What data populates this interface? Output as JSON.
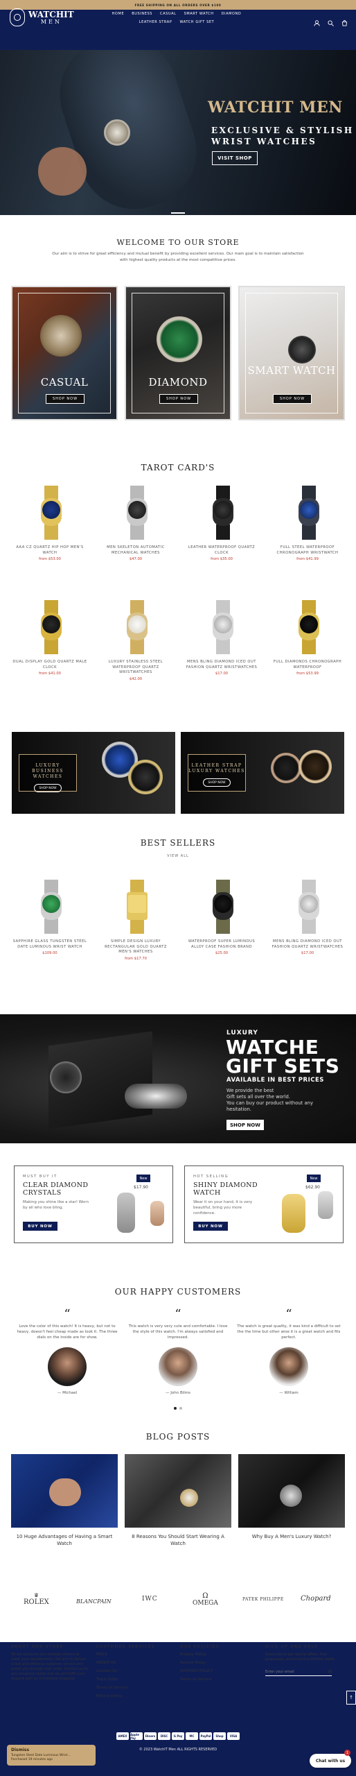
{
  "topbar": {
    "text": "FREE SHIPPING ON ALL ORDERS OVER $100"
  },
  "logo": {
    "line1": "WATCHIT",
    "line2": "MEN"
  },
  "nav": {
    "items": [
      "HOME",
      "BUSINESS",
      "CASUAL",
      "SMART WATCH",
      "DIAMOND",
      "LEATHER STRAP",
      "WATCH GIFT SET"
    ]
  },
  "header_icons": [
    "user-icon",
    "search-icon",
    "cart-icon"
  ],
  "hero": {
    "title": "WATCHIT MEN",
    "subtitle_line1": "EXCLUSIVE & STYLISH",
    "subtitle_line2": "WRIST WATCHES",
    "button": "VISIT SHOP"
  },
  "welcome": {
    "title": "WELCOME TO OUR STORE",
    "text": "Our aim is to strive for great efficiency and mutual benefit by providing excellent services. Our main goal is to maintain satisfaction with highest quality products at the most competitive prices."
  },
  "categories": [
    {
      "label": "CASUAL",
      "button": "SHOP NOW"
    },
    {
      "label": "DIAMOND",
      "button": "SHOP NOW"
    },
    {
      "label": "SMART WATCH",
      "button": "SHOP NOW"
    }
  ],
  "tarot": {
    "title": "TAROT CARD'S",
    "products": [
      {
        "name": "AAA CZ QUARTZ HIP HOP MEN'S WATCH",
        "price": "from $53.00"
      },
      {
        "name": "MEN SKELETON AUTOMATIC MECHANICAL WATCHES",
        "price": "$47.00"
      },
      {
        "name": "LEATHER WATERPROOF QUARTZ CLOCK",
        "price": "from $35.00"
      },
      {
        "name": "FULL STEEL WATERPROOF CHRONOGRAPH WRISTWATCH",
        "price": "from $41.99"
      },
      {
        "name": "DUAL DISPLAY GOLD QUARTZ MALE CLOCK",
        "price": "from $41.00"
      },
      {
        "name": "LUXURY STAINLESS STEEL WATERPROOF QUARTZ WRISTWATCHES",
        "price": "$42.00"
      },
      {
        "name": "MENS BLING DIAMOND ICED OUT FASHION QUARTZ WRISTWATCHES",
        "price": "$17.00"
      },
      {
        "name": "FULL DIAMONDS CHRONOGRAPH WATERPROOF",
        "price": "from $53.99"
      }
    ]
  },
  "banners": [
    {
      "line1": "LUXURY",
      "line2": "BUSINESS WATCHES",
      "button": "SHOP NOW"
    },
    {
      "line1": "LEATHER STRAP",
      "line2": "LUXURY WATCHES",
      "button": "SHOP NOW"
    }
  ],
  "best_sellers": {
    "title": "BEST SELLERS",
    "view_all": "VIEW ALL",
    "products": [
      {
        "name": "SAPPHIRE GLASS TUNGSTEN STEEL DATE LUMINOUS WRIST WATCH",
        "price": "$109.00"
      },
      {
        "name": "SIMPLE DESIGN LUXURY RECTANGULAR GOLD QUARTZ MEN'S WATCHES",
        "price": "from $17.70"
      },
      {
        "name": "WATERPROOF SUPER LUMINOUS ALLOY CASE FASHION BRAND",
        "price": "$25.00"
      },
      {
        "name": "MENS BLING DIAMOND ICED OUT FASHION QUARTZ WRISTWATCHES",
        "price": "$17.00"
      }
    ]
  },
  "gift": {
    "line1": "LUXURY",
    "line2a": "WATCHE",
    "line2b": "GIFT SETS",
    "line3": "AVAILABLE IN BEST PRICES",
    "desc": [
      "We provide the best",
      "Gift sets all over the world.",
      "You can buy our product without any",
      "hesitation."
    ],
    "button": "SHOP NOW"
  },
  "promos": [
    {
      "kicker": "MUST BUY IT",
      "title1": "CLEAR DIAMOND",
      "title2": "CRYSTALS",
      "desc": "Making you shine like a star! Worn by all who love bling.",
      "button": "BUY NOW",
      "badge": "New",
      "price": "$17.90"
    },
    {
      "kicker": "HOT SELLING",
      "title1": "SHINY DIAMOND",
      "title2": "WATCH",
      "desc": "Wear it on your hand, it is very beautiful, bring you more confidence.",
      "button": "BUY NOW",
      "badge": "New",
      "price": "$62.90"
    }
  ],
  "customers": {
    "title": "OUR HAPPY CUSTOMERS",
    "reviews": [
      {
        "text": "Love the color of this watch! It is heavy, but not to heavy, doesn't feel cheap made as look it. The three dials on the inside are for show.",
        "name": "— Michael"
      },
      {
        "text": "This watch is very very cute and comfortable. I love the style of this watch. I'm always satisfied and impressed.",
        "name": "— John Bilms"
      },
      {
        "text": "The watch is great quality, it was kind a difficult to set the the time but other wise it is a great watch and fits perfect.",
        "name": "— William"
      }
    ]
  },
  "blog": {
    "title": "BLOG POSTS",
    "posts": [
      "10 Huge Advantages of Having a Smart Watch",
      "8 Reasons You Should Start Wearing A Watch",
      "Why Buy A Men's Luxury Watch?"
    ]
  },
  "brands": [
    "ROLEX",
    "BLANCPAIN",
    "IWC",
    "OMEGA",
    "PATEK PHILIPPE",
    "Chopard"
  ],
  "footer": {
    "about": {
      "title": "ABOUT OUR STORE",
      "text": "All our products are carefully chosen to meet your requirements. We aim to deliver a fast and effective customer service and assist you through your order. Contact us for any shopping needs and we will fulfill your request with an immediate response."
    },
    "services": {
      "title": "CUSTOMER SERVICES",
      "items": [
        "FAQ'S",
        "ABOUT US",
        "Contact Us",
        "Track Order",
        "Terms of Service",
        "Refund policy"
      ]
    },
    "policies": {
      "title": "OUR POLICIES",
      "items": [
        "Privacy Policy",
        "Refund Policy",
        "SHIPPING POLICY",
        "Terms of Service"
      ]
    },
    "signup": {
      "title": "SIGN UP AND SAVE",
      "text": "Subscribe to get special offers, free giveaways, and once-in-a-lifetime deals.",
      "placeholder": "Enter your email"
    },
    "payments": [
      "AMEX",
      "Apple Pay",
      "Diners",
      "DISC",
      "G Pay",
      "MC",
      "PayPal",
      "Shop",
      "VISA"
    ],
    "copyright": "© 2023 WatchIT Men ALL RIGHTS RESERVED"
  },
  "dismiss": {
    "label": "Dismiss",
    "text": "Tungsten Steel Date Luminous Wrist... Purchased 19 minutes ago"
  },
  "chat": {
    "label": "Chat with us",
    "badge": "1"
  }
}
